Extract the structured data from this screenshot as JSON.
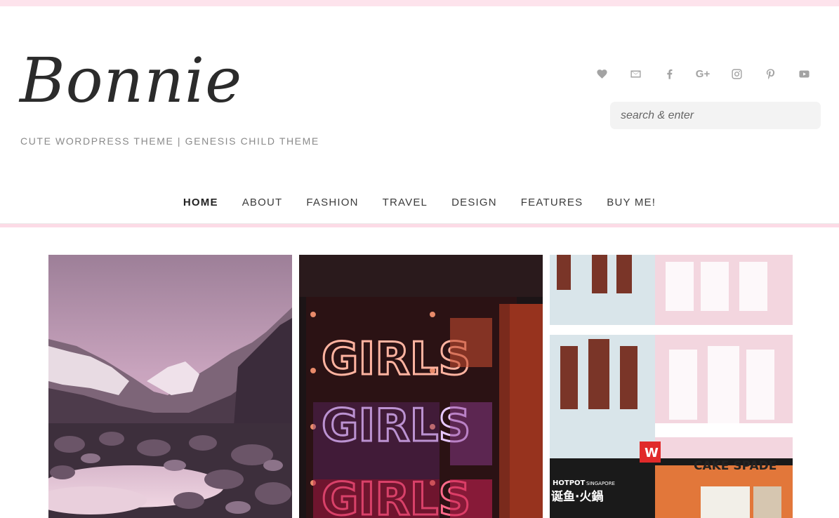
{
  "site": {
    "title": "Bonnie",
    "tagline": "CUTE WORDPRESS THEME | GENESIS CHILD THEME"
  },
  "social": [
    {
      "name": "heart-icon"
    },
    {
      "name": "email-icon"
    },
    {
      "name": "facebook-icon"
    },
    {
      "name": "google-plus-icon",
      "label": "G+"
    },
    {
      "name": "instagram-icon"
    },
    {
      "name": "pinterest-icon"
    },
    {
      "name": "youtube-icon"
    }
  ],
  "search": {
    "placeholder": "search & enter"
  },
  "nav": {
    "items": [
      {
        "label": "HOME",
        "active": true
      },
      {
        "label": "ABOUT"
      },
      {
        "label": "FASHION"
      },
      {
        "label": "TRAVEL"
      },
      {
        "label": "DESIGN"
      },
      {
        "label": "FEATURES"
      },
      {
        "label": "BUY ME!"
      }
    ]
  },
  "cards": [
    {
      "name": "mountain-lake-photo"
    },
    {
      "name": "neon-sign-photo",
      "sign_text": "GIRLS"
    },
    {
      "name": "shophouse-street-photo",
      "shop_sign": "CAKE SPADE",
      "hotpot_sign": "HOTPOT",
      "hotpot_city": "SINGAPORE",
      "chinese_text": "诞鱼·火鍋",
      "hotpot_logo": "W"
    }
  ],
  "colors": {
    "accent_pink": "#fcdbe6",
    "top_strip": "#fde3ec",
    "icon_grey": "#a3a3a3",
    "search_bg": "#f3f3f3"
  }
}
